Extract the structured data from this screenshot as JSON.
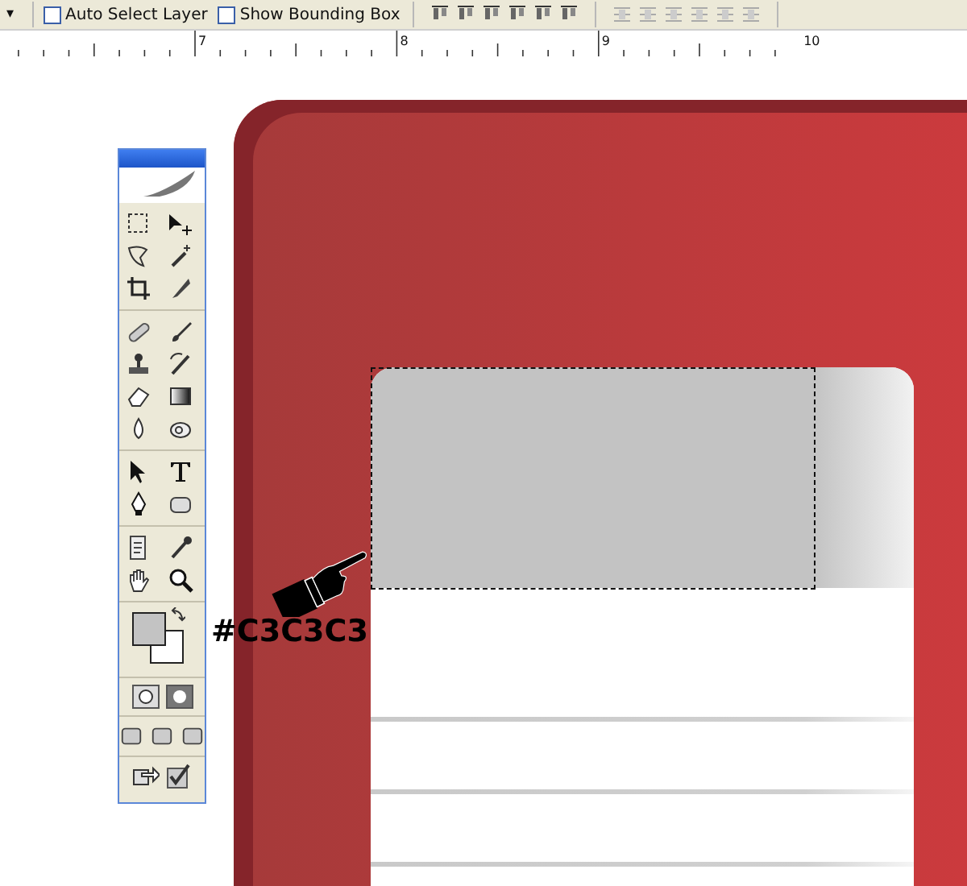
{
  "options_bar": {
    "menu_arrow": "▾",
    "checkboxes": [
      {
        "label": "Auto Select Layer",
        "checked": false
      },
      {
        "label": "Show Bounding Box",
        "checked": false
      }
    ]
  },
  "ruler": {
    "labels": [
      "7",
      "8",
      "9",
      "10"
    ]
  },
  "annotation": {
    "text": "#C3C3C3"
  }
}
